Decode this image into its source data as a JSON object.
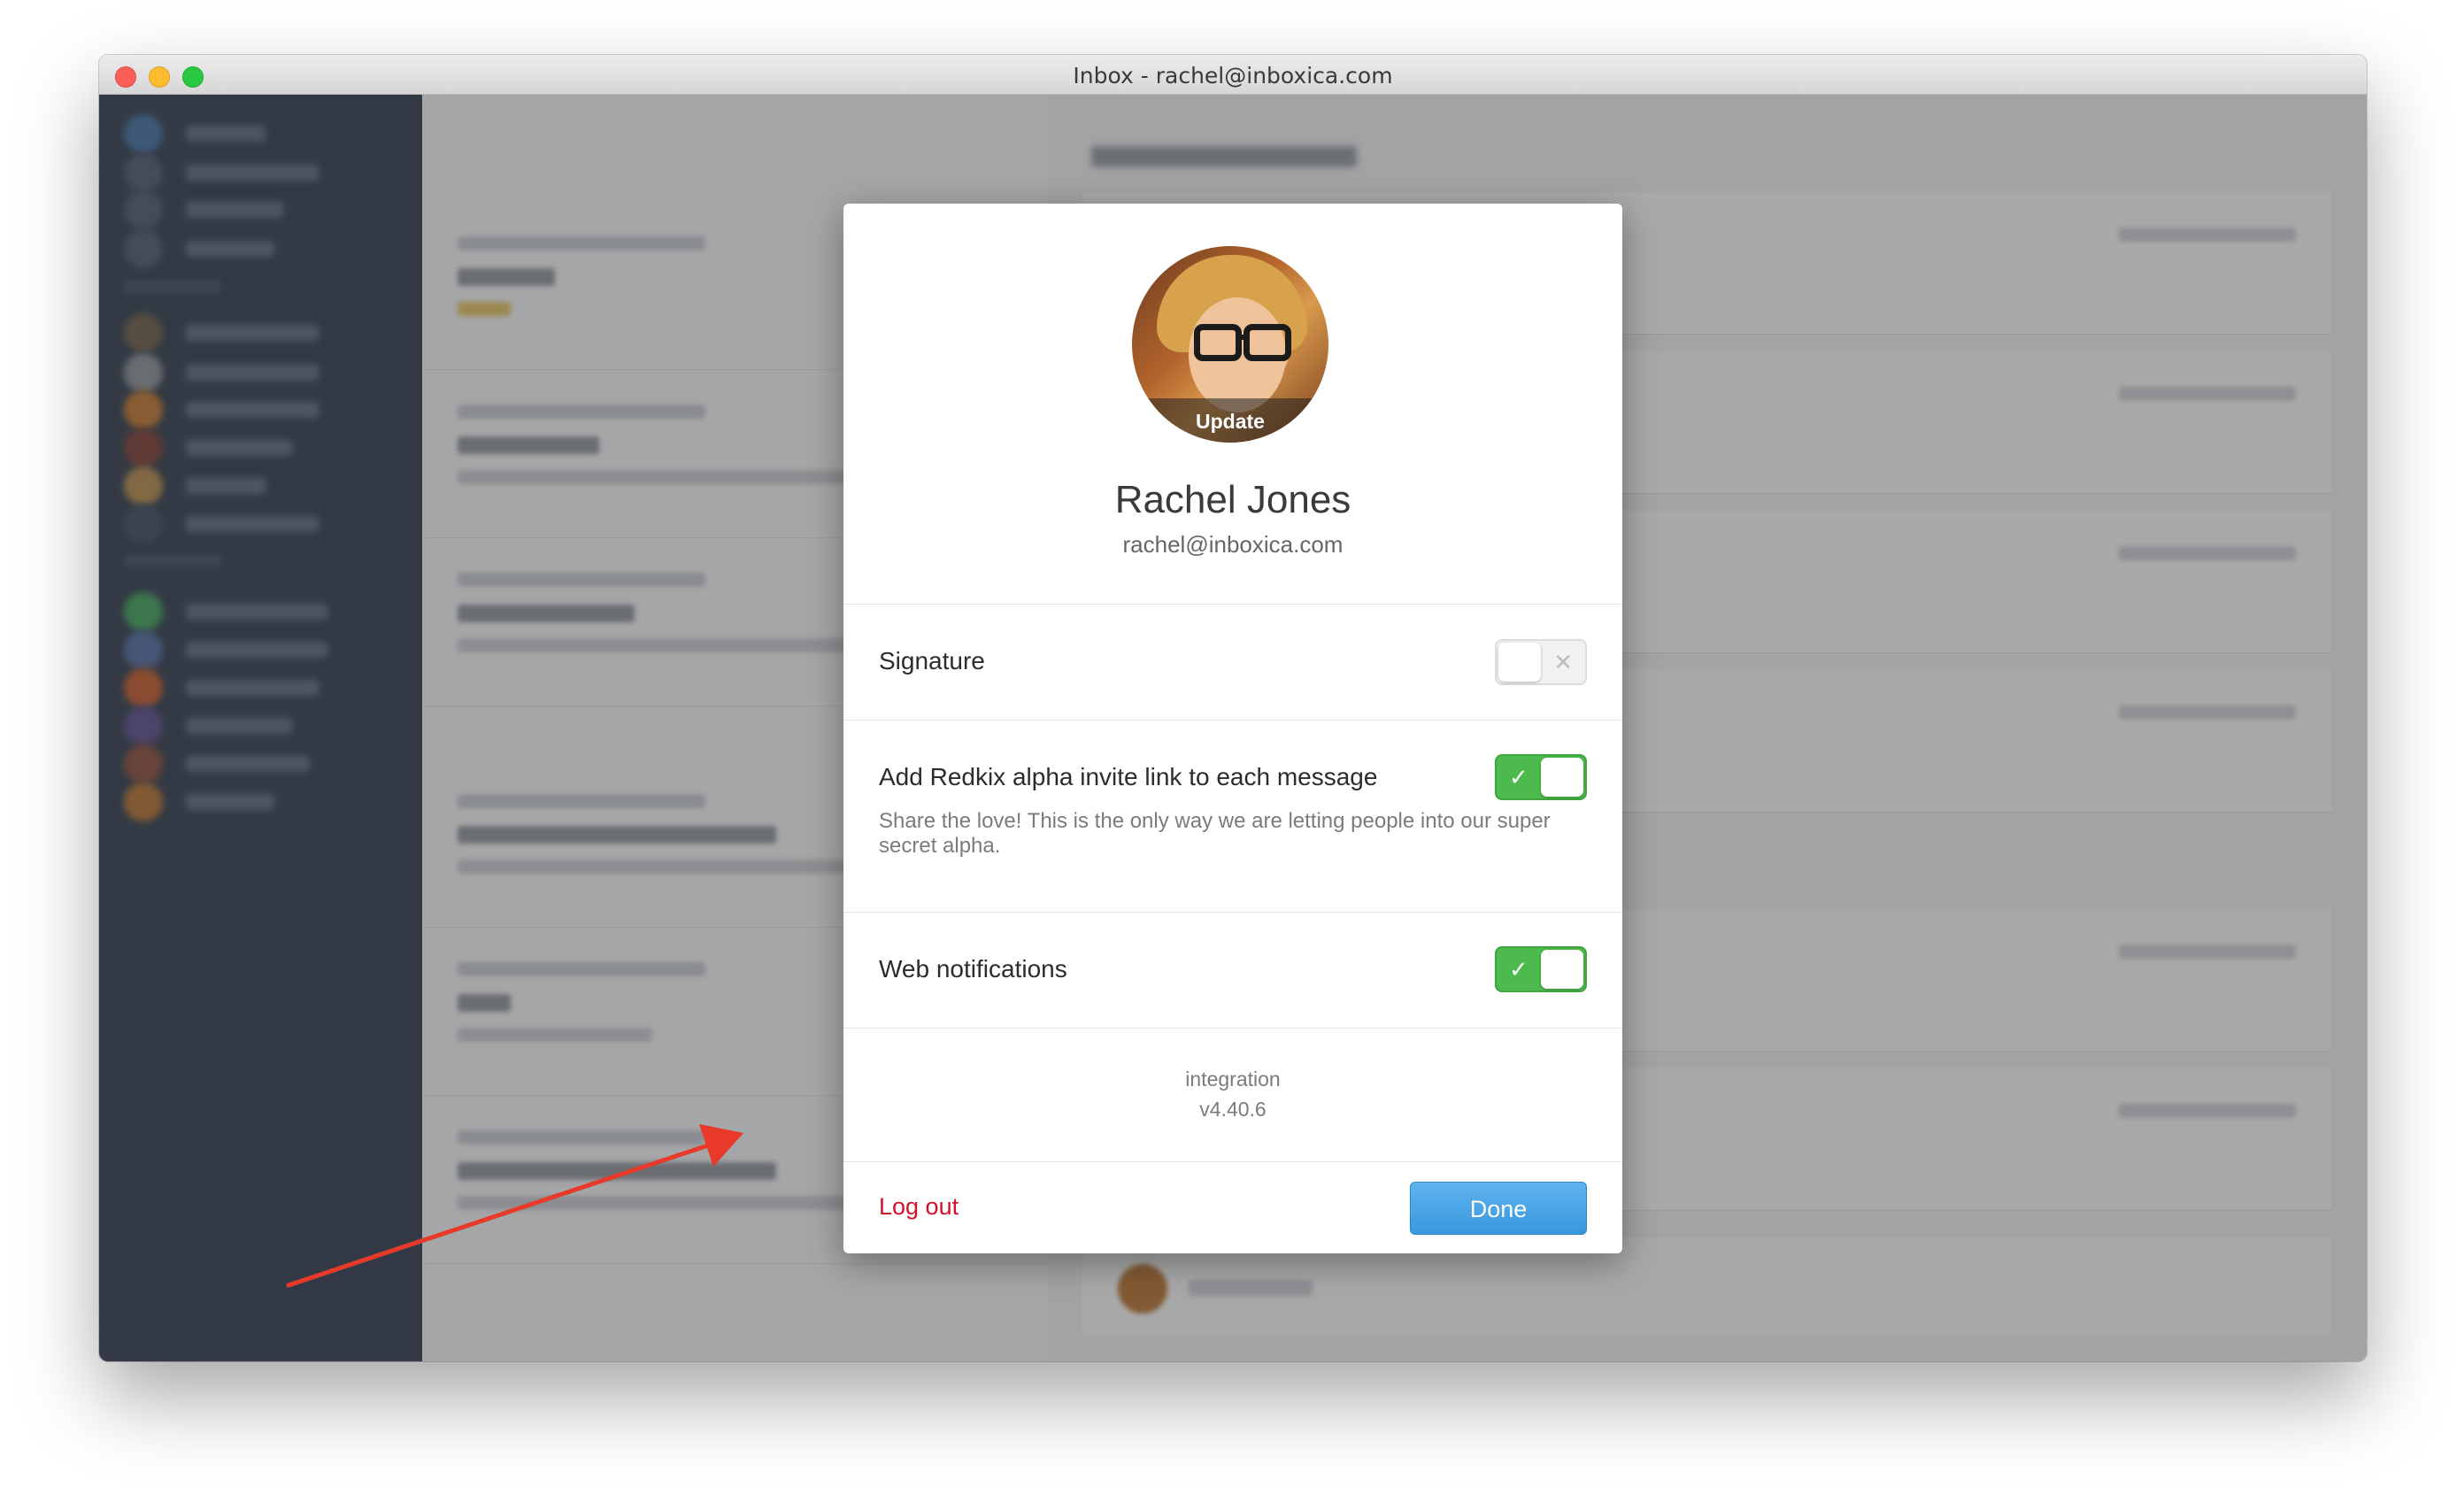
{
  "window": {
    "title": "Inbox - rachel@inboxica.com"
  },
  "modal": {
    "avatar": {
      "update_label": "Update"
    },
    "profile": {
      "name": "Rachel Jones",
      "email": "rachel@inboxica.com"
    },
    "settings": [
      {
        "label": "Signature",
        "enabled": false,
        "icon": "cross-icon"
      },
      {
        "label": "Add Redkix alpha invite link to each message",
        "description": "Share the love! This is the only way we are letting people into our super secret alpha.",
        "enabled": true,
        "icon": "check-icon"
      },
      {
        "label": "Web notifications",
        "enabled": true,
        "icon": "check-icon"
      }
    ],
    "version": {
      "environment": "integration",
      "number": "v4.40.6"
    },
    "footer": {
      "logout_label": "Log out",
      "done_label": "Done"
    }
  },
  "colors": {
    "toggle_on": "#4cba4c",
    "logout": "#d0112b",
    "done_button": "#3a97de",
    "annotation_arrow": "#e8392b",
    "sidebar": "#2d3a4c"
  }
}
